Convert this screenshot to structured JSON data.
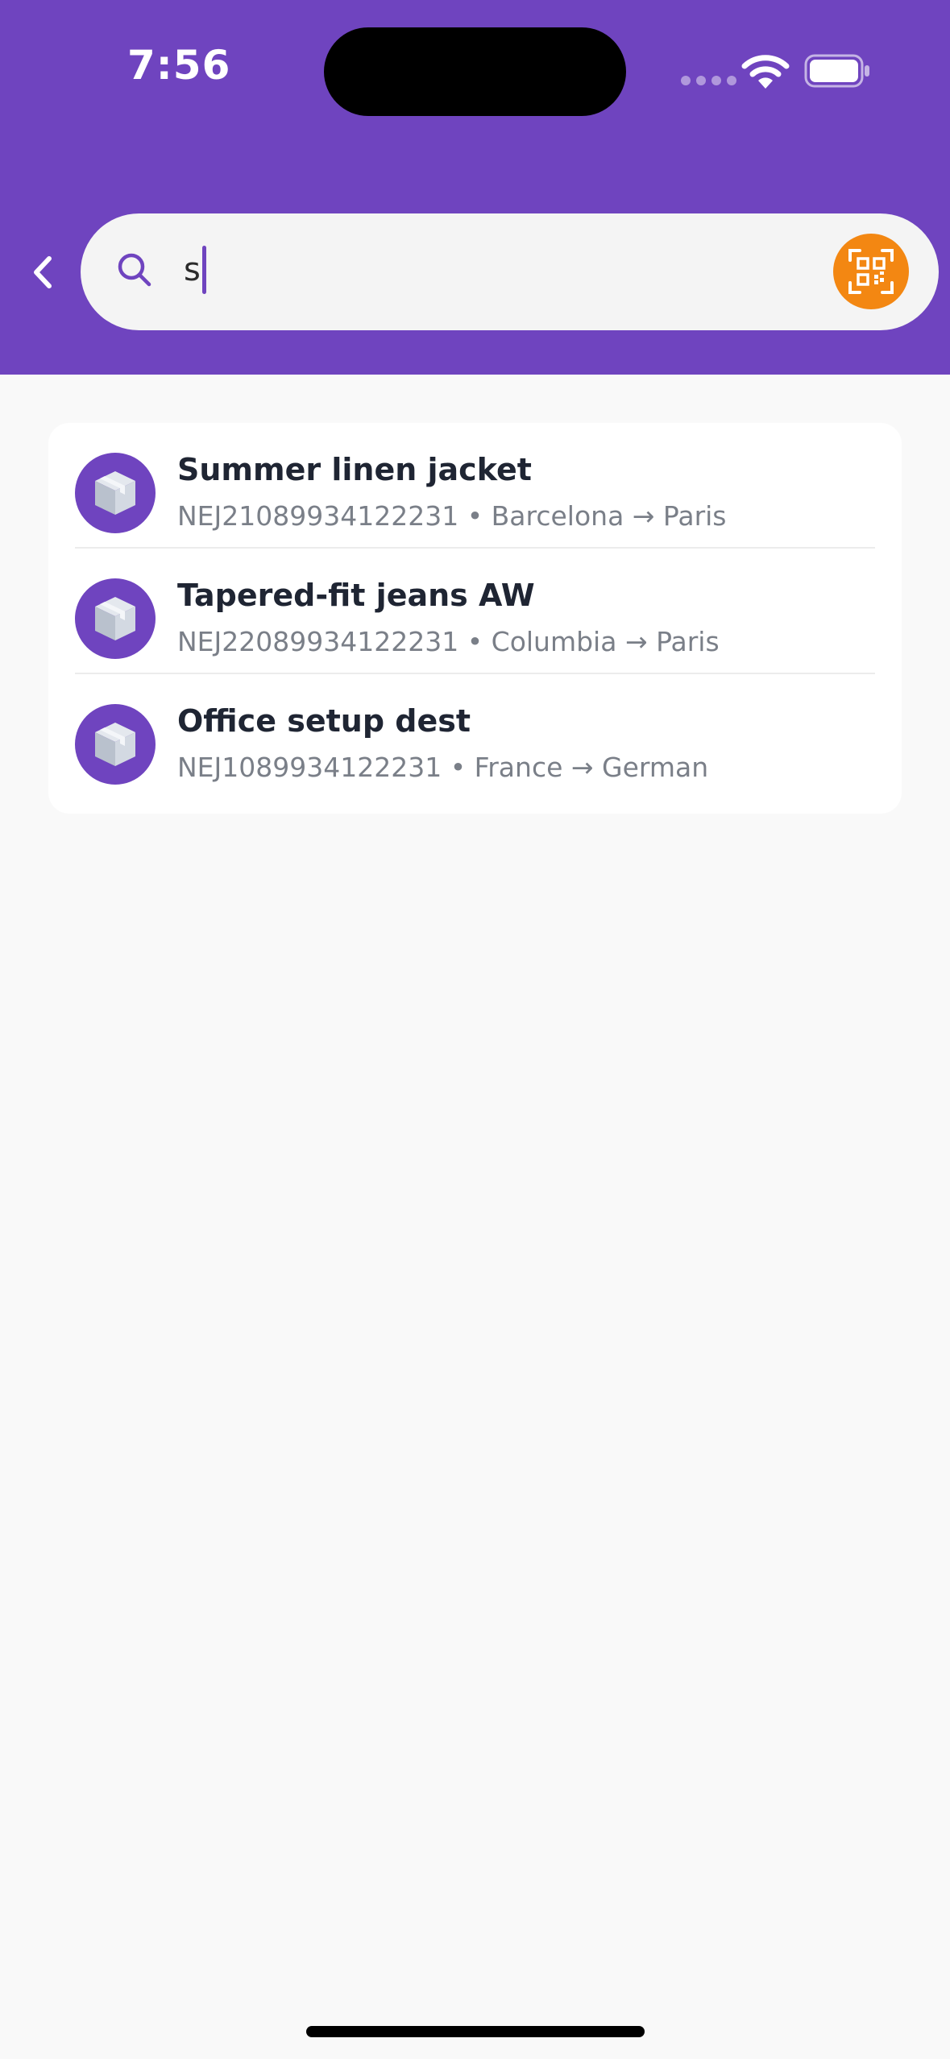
{
  "status_bar": {
    "time": "7:56",
    "icons": [
      "signal-dots-icon",
      "wifi-icon",
      "battery-icon"
    ]
  },
  "header": {
    "back_icon": "chevron-left-icon",
    "search": {
      "icon": "search-icon",
      "value": "s",
      "scan_icon": "qr-scan-icon"
    }
  },
  "results": [
    {
      "icon": "package-box-icon",
      "title": "Summer linen jacket",
      "subtitle": "NEJ21089934122231 • Barcelona → Paris"
    },
    {
      "icon": "package-box-icon",
      "title": "Tapered-fit jeans AW",
      "subtitle": "NEJ22089934122231 • Columbia → Paris"
    },
    {
      "icon": "package-box-icon",
      "title": "Office setup dest",
      "subtitle": "NEJ1089934122231 • France → German"
    }
  ],
  "colors": {
    "brand": "#6f44bf",
    "accent": "#f38712",
    "background": "#f9f9f9",
    "card": "#ffffff",
    "title_text": "#1f2533",
    "subtitle_text": "#7a7f88"
  }
}
